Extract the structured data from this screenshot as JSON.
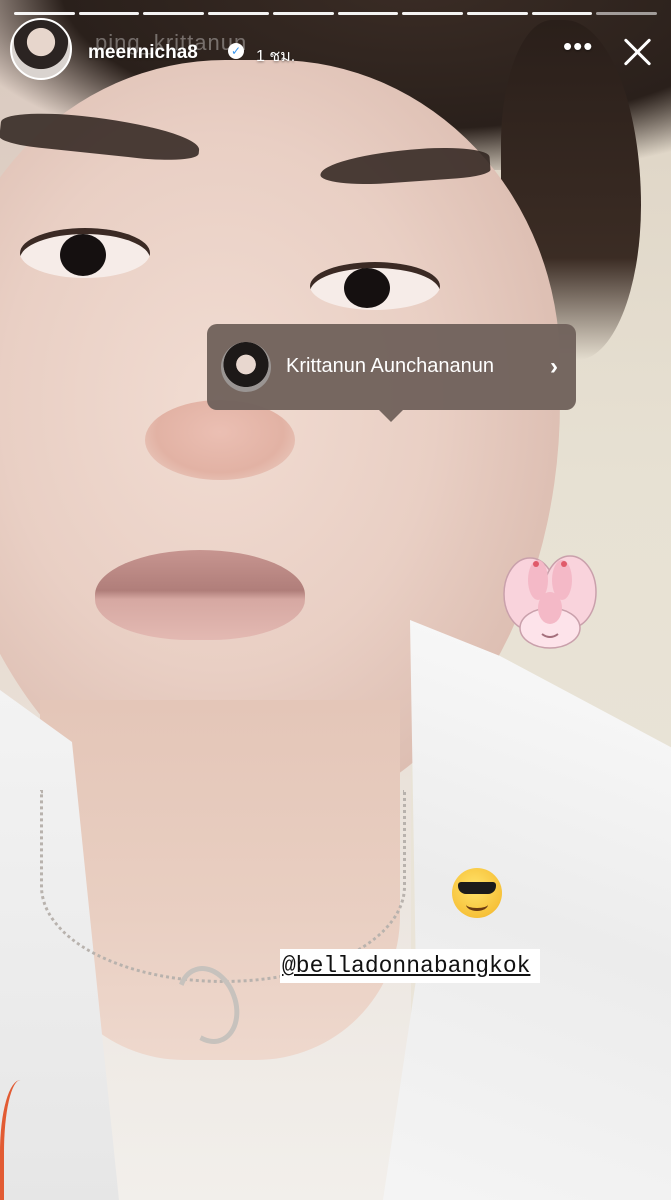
{
  "story": {
    "progress_segments": 10,
    "progress_completed": 9,
    "header": {
      "username": "meennicha8",
      "verified_icon": "verified-badge-icon",
      "time": "1 ชม.",
      "more_icon": "more-dots-icon",
      "close_icon": "close-icon",
      "ghost_text": "ping_krittanun"
    },
    "tag": {
      "name": "Krittanun Aunchananun",
      "chevron": "›"
    },
    "sticker": {
      "emoji": "sunglasses-emoji",
      "mention": "@belladonnabangkok"
    }
  }
}
